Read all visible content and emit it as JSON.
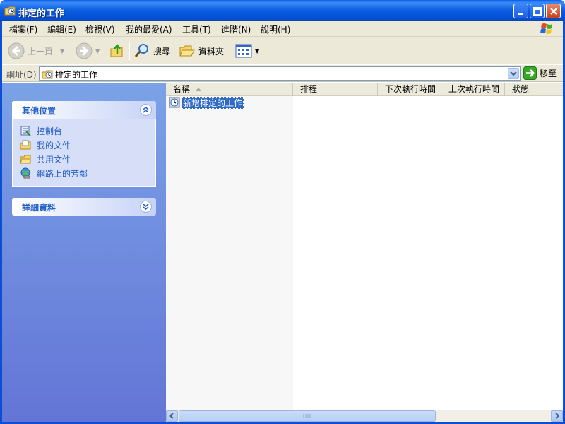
{
  "window": {
    "title": "排定的工作"
  },
  "menu": [
    "檔案(F)",
    "編輯(E)",
    "檢視(V)",
    "我的最愛(A)",
    "工具(T)",
    "進階(N)",
    "說明(H)"
  ],
  "toolbar": {
    "back": "上一頁",
    "search": "搜尋",
    "folders": "資料夾"
  },
  "address": {
    "label": "網址(D)",
    "value": "排定的工作",
    "go": "移至"
  },
  "taskpane": {
    "other_places": {
      "title": "其他位置",
      "links": [
        "控制台",
        "我的文件",
        "共用文件",
        "網路上的芳鄰"
      ]
    },
    "details": {
      "title": "詳細資料"
    }
  },
  "list": {
    "columns": [
      "名稱",
      "排程",
      "下次執行時間",
      "上次執行時間",
      "狀態"
    ],
    "rows": [
      {
        "name": "新增排定的工作"
      }
    ]
  },
  "colors": {
    "titlebar": "#0a5ce0",
    "pane_top": "#7ba2e7",
    "pane_bottom": "#6375d6",
    "selection": "#316ac5",
    "link": "#215dc6"
  }
}
